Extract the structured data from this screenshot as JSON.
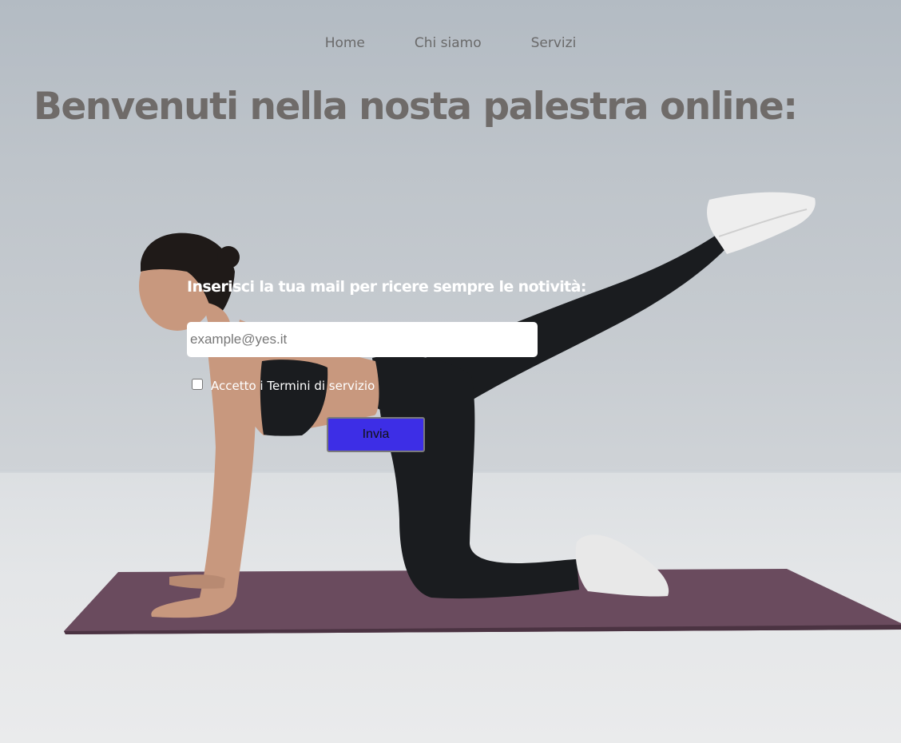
{
  "nav": {
    "items": [
      {
        "label": "Home"
      },
      {
        "label": "Chi siamo"
      },
      {
        "label": "Servizi"
      }
    ]
  },
  "hero": {
    "headline": "Benvenuti nella nosta palestra online:"
  },
  "newsletter": {
    "title": "Inserisci la tua mail per ricere sempre le notività:",
    "email_placeholder": "example@yes.it",
    "email_value": "",
    "terms_label": "Accetto i Termini di servizio",
    "terms_checked": false,
    "submit_label": "Invia"
  },
  "colors": {
    "submit_button": "#3d2ee6",
    "headline": "#6f6b69",
    "nav_text": "#6a6a6a",
    "yoga_mat": "#6a4b5e"
  }
}
